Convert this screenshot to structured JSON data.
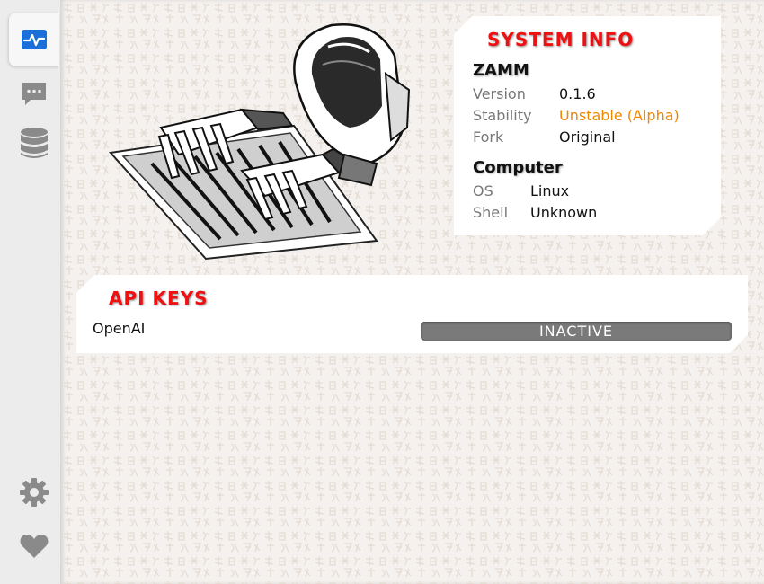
{
  "sidebar": {
    "items": [
      {
        "icon": "dashboard-icon",
        "active": true
      },
      {
        "icon": "chat-icon",
        "active": false
      },
      {
        "icon": "database-icon",
        "active": false
      }
    ],
    "bottom_items": [
      {
        "icon": "gear-icon"
      },
      {
        "icon": "heart-icon"
      }
    ]
  },
  "system_info": {
    "title": "SYSTEM INFO",
    "app_section": {
      "title": "ZAMM",
      "rows": [
        {
          "label": "Version",
          "value": "0.1.6"
        },
        {
          "label": "Stability",
          "value": "Unstable (Alpha)"
        },
        {
          "label": "Fork",
          "value": "Original"
        }
      ]
    },
    "computer_section": {
      "title": "Computer",
      "rows": [
        {
          "label": "OS",
          "value": "Linux"
        },
        {
          "label": "Shell",
          "value": "Unknown"
        }
      ]
    }
  },
  "api_keys": {
    "title": "API KEYS",
    "rows": [
      {
        "service": "OpenAI",
        "status": "INACTIVE"
      }
    ]
  },
  "colors": {
    "accent": "#ee1111",
    "active_icon": "#1a6fd9",
    "inactive_icon": "#888888",
    "warning": "#ee8800",
    "inactive_status": "#7a7a7a"
  }
}
